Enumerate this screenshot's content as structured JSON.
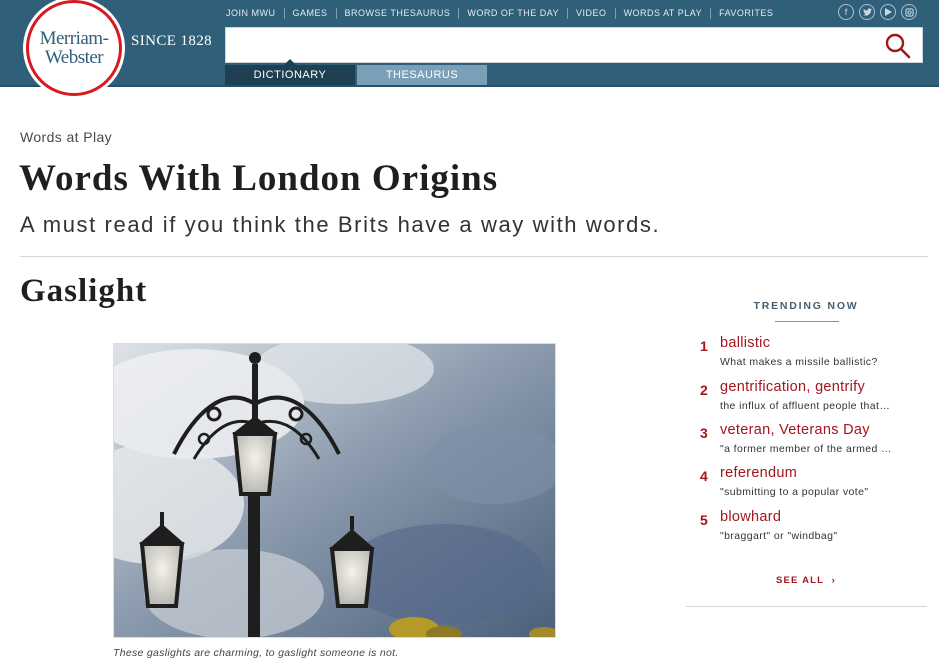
{
  "brand": {
    "logo_line1": "Merriam-",
    "logo_line2": "Webster",
    "since": "SINCE 1828"
  },
  "top_nav": [
    "JOIN MWU",
    "GAMES",
    "BROWSE THESAURUS",
    "WORD OF THE DAY",
    "VIDEO",
    "WORDS AT PLAY",
    "FAVORITES"
  ],
  "social_icons": [
    "facebook-icon",
    "twitter-icon",
    "youtube-icon",
    "instagram-icon"
  ],
  "search": {
    "value": "",
    "placeholder": ""
  },
  "tabs": [
    {
      "label": "DICTIONARY",
      "active": true
    },
    {
      "label": "THESAURUS",
      "active": false
    }
  ],
  "article": {
    "eyebrow": "Words at Play",
    "title": "Words With London Origins",
    "subtitle": "A must read if you think the Brits have a way with words.",
    "section_title": "Gaslight",
    "image_caption": "These gaslights are charming, to gaslight someone is not."
  },
  "trending": {
    "heading": "TRENDING NOW",
    "items": [
      {
        "rank": "1",
        "word": "ballistic",
        "desc": "What makes a missile ballistic?"
      },
      {
        "rank": "2",
        "word": "gentrification, gentrify",
        "desc": "the influx of affluent people that…"
      },
      {
        "rank": "3",
        "word": "veteran, Veterans Day",
        "desc": "\"a former member of the armed …"
      },
      {
        "rank": "4",
        "word": "referendum",
        "desc": "\"submitting to a popular vote\""
      },
      {
        "rank": "5",
        "word": "blowhard",
        "desc": "\"braggart\" or \"windbag\""
      }
    ],
    "see_all": "SEE ALL"
  },
  "colors": {
    "header_blue": "#305f7a",
    "brand_red": "#d71920",
    "link_red": "#a4151d",
    "tab_active": "#1f3f53",
    "tab_inactive": "#7a9fb6"
  }
}
